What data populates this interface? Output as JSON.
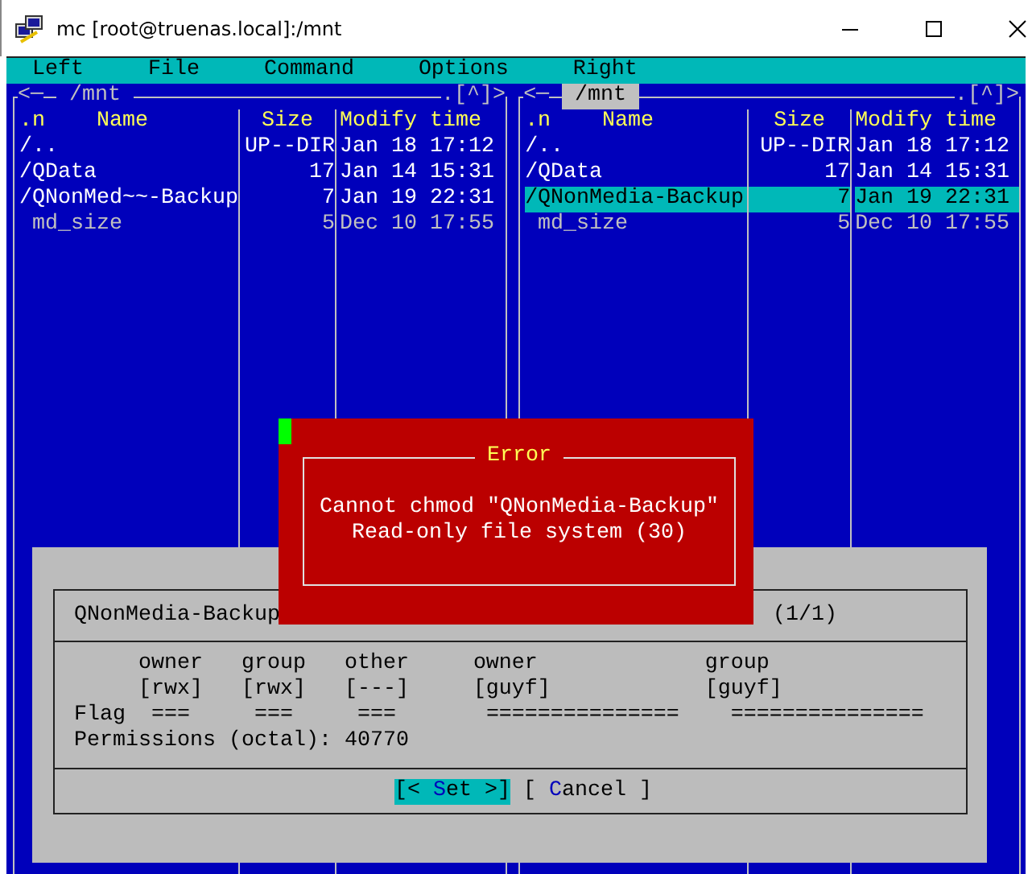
{
  "window": {
    "title": "mc [root@truenas.local]:/mnt"
  },
  "menu": [
    {
      "label": "Left"
    },
    {
      "label": "File"
    },
    {
      "label": "Command"
    },
    {
      "label": "Options"
    },
    {
      "label": "Right"
    }
  ],
  "panels": [
    {
      "active": false,
      "nav_left": "<─",
      "path": "/mnt",
      "nav_right": ".[^]>",
      "columns": {
        "sort": ".n",
        "name": "Name",
        "size": "Size",
        "time": "Modify time"
      },
      "rows": [
        {
          "name": "/..",
          "size": "UP--DIR",
          "time": "Jan 18 17:12",
          "kind": "dir",
          "selected": false
        },
        {
          "name": "/QData",
          "size": "17",
          "time": "Jan 14 15:31",
          "kind": "dir",
          "selected": false
        },
        {
          "name": "/QNonMed~~-Backup",
          "size": "7",
          "time": "Jan 19 22:31",
          "kind": "dir",
          "selected": false
        },
        {
          "name": "md_size",
          "size": "5",
          "time": "Dec 10 17:55",
          "kind": "file",
          "selected": false
        }
      ]
    },
    {
      "active": true,
      "nav_left": "<─",
      "path": "/mnt",
      "nav_right": ".[^]>",
      "columns": {
        "sort": ".n",
        "name": "Name",
        "size": "Size",
        "time": "Modify time"
      },
      "rows": [
        {
          "name": "/..",
          "size": "UP--DIR",
          "time": "Jan 18 17:12",
          "kind": "dir",
          "selected": false
        },
        {
          "name": "/QData",
          "size": "17",
          "time": "Jan 14 15:31",
          "kind": "dir",
          "selected": false
        },
        {
          "name": "/QNonMedia-Backup",
          "size": "7",
          "time": "Jan 19 22:31",
          "kind": "dir",
          "selected": true
        },
        {
          "name": "md_size",
          "size": "5",
          "time": "Dec 10 17:55",
          "kind": "file",
          "selected": false
        }
      ]
    }
  ],
  "permissions_dialog": {
    "filename": "QNonMedia-Backup",
    "counter": "(1/1)",
    "headers": [
      "owner",
      "group",
      "other",
      "owner",
      "group"
    ],
    "values": [
      "[rwx]",
      "[rwx]",
      "[---]",
      "[guyf]",
      "[guyf]"
    ],
    "flag_label": "Flag",
    "flags": [
      "===",
      "===",
      "===",
      "===============",
      "==============="
    ],
    "octal": "Permissions (octal): 40770",
    "buttons": [
      {
        "before": "[< ",
        "hotkey": "S",
        "after": "et >]",
        "selected": true
      },
      {
        "before": "[ ",
        "hotkey": "C",
        "after": "ancel ]",
        "selected": false
      }
    ]
  },
  "error_dialog": {
    "title": "Error",
    "lines": [
      "Cannot chmod \"QNonMedia-Backup\"",
      "Read-only file system (30)"
    ]
  }
}
